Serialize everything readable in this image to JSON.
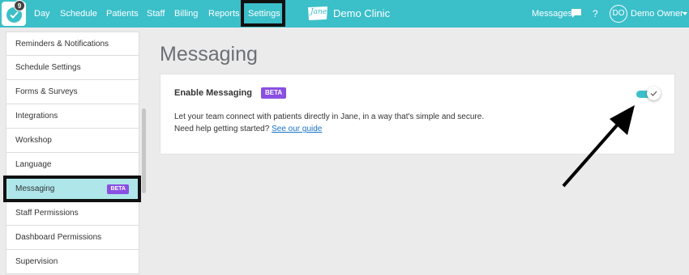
{
  "topbar": {
    "notification_count": "9",
    "nav": [
      "Day",
      "Schedule",
      "Patients",
      "Staff",
      "Billing",
      "Reports",
      "Settings"
    ],
    "brand_logo": "Jane",
    "clinic_name": "Demo Clinic",
    "messages_label": "Messages",
    "help_label": "?",
    "avatar_initials": "DO",
    "user_name": "Demo Owner",
    "bar_color": "#3bbfc9"
  },
  "sidebar": {
    "items": [
      {
        "label": "Reminders & Notifications"
      },
      {
        "label": "Schedule Settings"
      },
      {
        "label": "Forms & Surveys"
      },
      {
        "label": "Integrations"
      },
      {
        "label": "Workshop"
      },
      {
        "label": "Language"
      },
      {
        "label": "Messaging",
        "badge": "BETA",
        "active": true
      },
      {
        "label": "Staff Permissions"
      },
      {
        "label": "Dashboard Permissions"
      },
      {
        "label": "Supervision"
      }
    ]
  },
  "main": {
    "title": "Messaging",
    "card": {
      "title": "Enable Messaging",
      "badge": "BETA",
      "description": "Let your team connect with patients directly in Jane, in a way that's simple and secure.",
      "help_prefix": "Need help getting started?",
      "help_link": "See our guide",
      "toggle_on": true
    }
  },
  "colors": {
    "accent": "#3bbfc9",
    "badge": "#8a4fe2",
    "active_item": "#aee6ea",
    "link": "#1a73c8"
  }
}
